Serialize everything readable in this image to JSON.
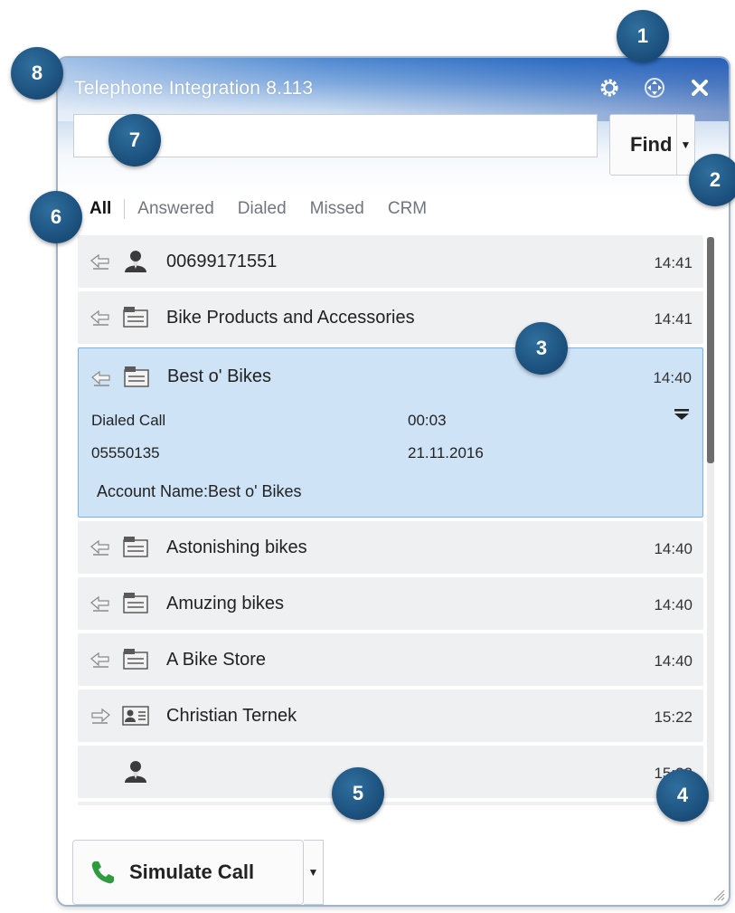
{
  "window": {
    "title": "Telephone Integration 8.113"
  },
  "titlebar_icons": [
    {
      "name": "settings",
      "icon": "gear-icon"
    },
    {
      "name": "move",
      "icon": "move-icon"
    },
    {
      "name": "close",
      "icon": "close-icon"
    }
  ],
  "search": {
    "value": "",
    "placeholder": ""
  },
  "find_button": {
    "label": "Find",
    "dropdown_icon": "caret-down-icon"
  },
  "tabs": [
    {
      "label": "All",
      "active": true
    },
    {
      "label": "Answered",
      "active": false
    },
    {
      "label": "Dialed",
      "active": false
    },
    {
      "label": "Missed",
      "active": false
    },
    {
      "label": "CRM",
      "active": false
    }
  ],
  "calls": [
    {
      "direction": "incoming",
      "contact_type": "person-icon",
      "name": "00699171551",
      "time": "14:41"
    },
    {
      "direction": "incoming",
      "contact_type": "account-icon",
      "name": "Bike Products and Accessories",
      "time": "14:41"
    },
    {
      "direction": "incoming",
      "contact_type": "account-icon",
      "name": "Best o' Bikes",
      "time": "14:40",
      "expanded": true,
      "details": {
        "call_type": "Dialed Call",
        "duration": "00:03",
        "number": "05550135",
        "date": "21.11.2016",
        "account": "Account Name:Best o' Bikes"
      }
    },
    {
      "direction": "incoming",
      "contact_type": "account-icon",
      "name": "Astonishing bikes",
      "time": "14:40"
    },
    {
      "direction": "incoming",
      "contact_type": "account-icon",
      "name": "Amuzing bikes",
      "time": "14:40"
    },
    {
      "direction": "incoming",
      "contact_type": "account-icon",
      "name": "A Bike Store",
      "time": "14:40"
    },
    {
      "direction": "outgoing",
      "contact_type": "contact-card-icon",
      "name": "Christian Ternek",
      "time": "15:22"
    },
    {
      "direction": "none",
      "contact_type": "person-icon",
      "name": "",
      "time": "15:22"
    }
  ],
  "simulate_call": {
    "label": "Simulate Call",
    "icon": "phone-icon",
    "dropdown_icon": "caret-down-icon"
  },
  "callouts": [
    "1",
    "2",
    "3",
    "4",
    "5",
    "6",
    "7",
    "8"
  ],
  "colors": {
    "title_gradient": "#2f73c9",
    "selected_row": "#cfe3f7",
    "row_bg": "#eef0f2",
    "callout": "#1a4d79",
    "phone_green": "#2e9b3f"
  }
}
